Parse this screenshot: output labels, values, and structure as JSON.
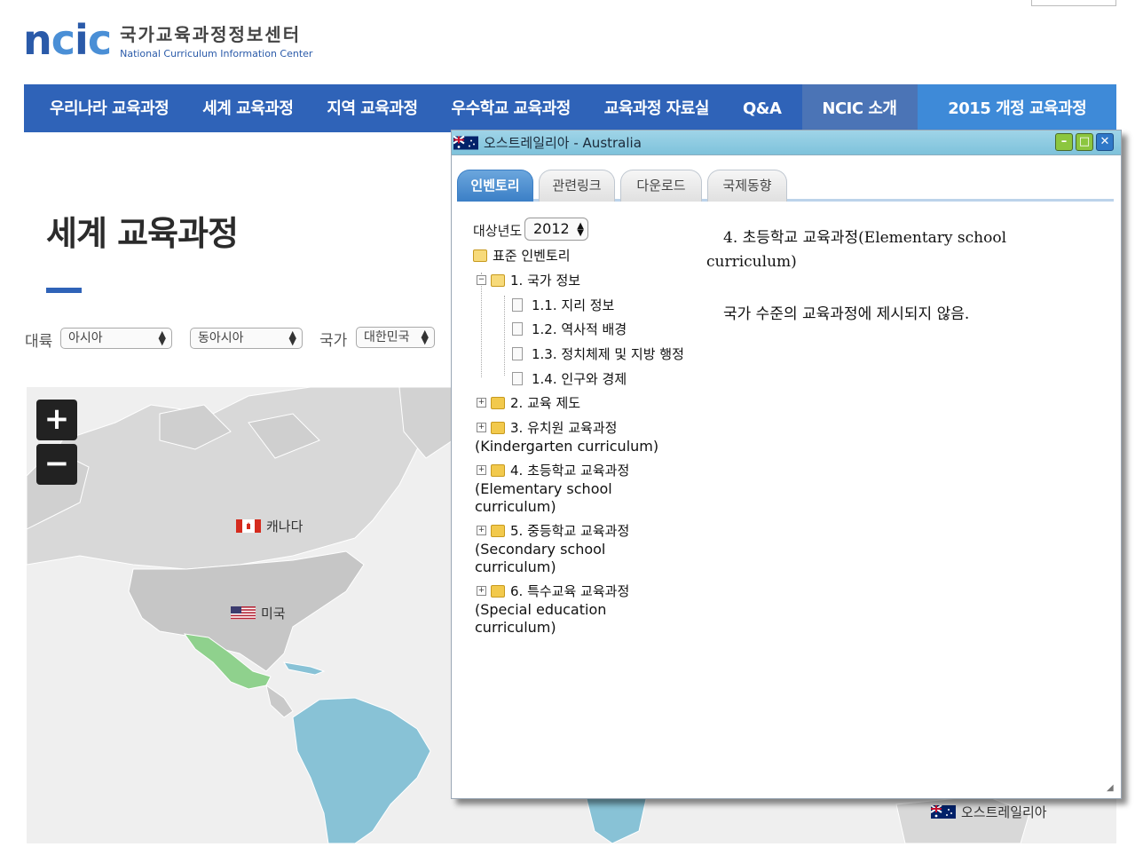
{
  "header": {
    "logo_mark": "ncic",
    "logo_ko": "국가교육과정정보센터",
    "logo_en": "National Curriculum Information Center"
  },
  "nav": {
    "items": [
      "우리나라 교육과정",
      "세계 교육과정",
      "지역 교육과정",
      "우수학교 교육과정",
      "교육과정 자료실",
      "Q&A",
      "NCIC 소개",
      "2015 개정 교육과정"
    ]
  },
  "page": {
    "title": "세계 교육과정"
  },
  "filters": {
    "continent_label": "대륙",
    "continent_value": "아시아",
    "region_value": "동아시아",
    "country_label": "국가",
    "country_value": "대한민국"
  },
  "map": {
    "zoom_in": "+",
    "zoom_out": "−",
    "labels": {
      "canada": "캐나다",
      "usa": "미국",
      "australia": "오스트레일리아"
    },
    "colors": {
      "land": "#d8d8d8",
      "north_america": "#c6c6c6",
      "mexico": "#8fd18d",
      "south_america": "#88c2d6",
      "ocean": "#efefef"
    }
  },
  "dialog": {
    "title": "오스트레일리아 - Australia",
    "tabs": [
      "인벤토리",
      "관련링크",
      "다운로드",
      "국제동향"
    ],
    "active_tab": "인벤토리",
    "year_label": "대상년도",
    "year_value": "2012",
    "tree": {
      "root": "표준 인벤토리",
      "n1": "1. 국가 정보",
      "n1_1": "1.1. 지리 정보",
      "n1_2": "1.2. 역사적 배경",
      "n1_3": "1.3. 정치체제 및 지방 행정",
      "n1_4": "1.4. 인구와 경제",
      "n2": "2. 교육 제도",
      "n3": "3. 유치원 교육과정",
      "n3_sub": "(Kindergarten curriculum)",
      "n4": "4. 초등학교 교육과정",
      "n4_sub1": "(Elementary school",
      "n4_sub2": "curriculum)",
      "n5": "5. 중등학교 교육과정",
      "n5_sub1": "(Secondary school",
      "n5_sub2": "curriculum)",
      "n6": "6. 특수교육 교육과정",
      "n6_sub1": "(Special education",
      "n6_sub2": "curriculum)"
    },
    "content": {
      "heading_line1": "4. 초등학교 교육과정(Elementary school",
      "heading_line2": "curriculum)",
      "body": "국가 수준의 교육과정에 제시되지 않음."
    }
  }
}
